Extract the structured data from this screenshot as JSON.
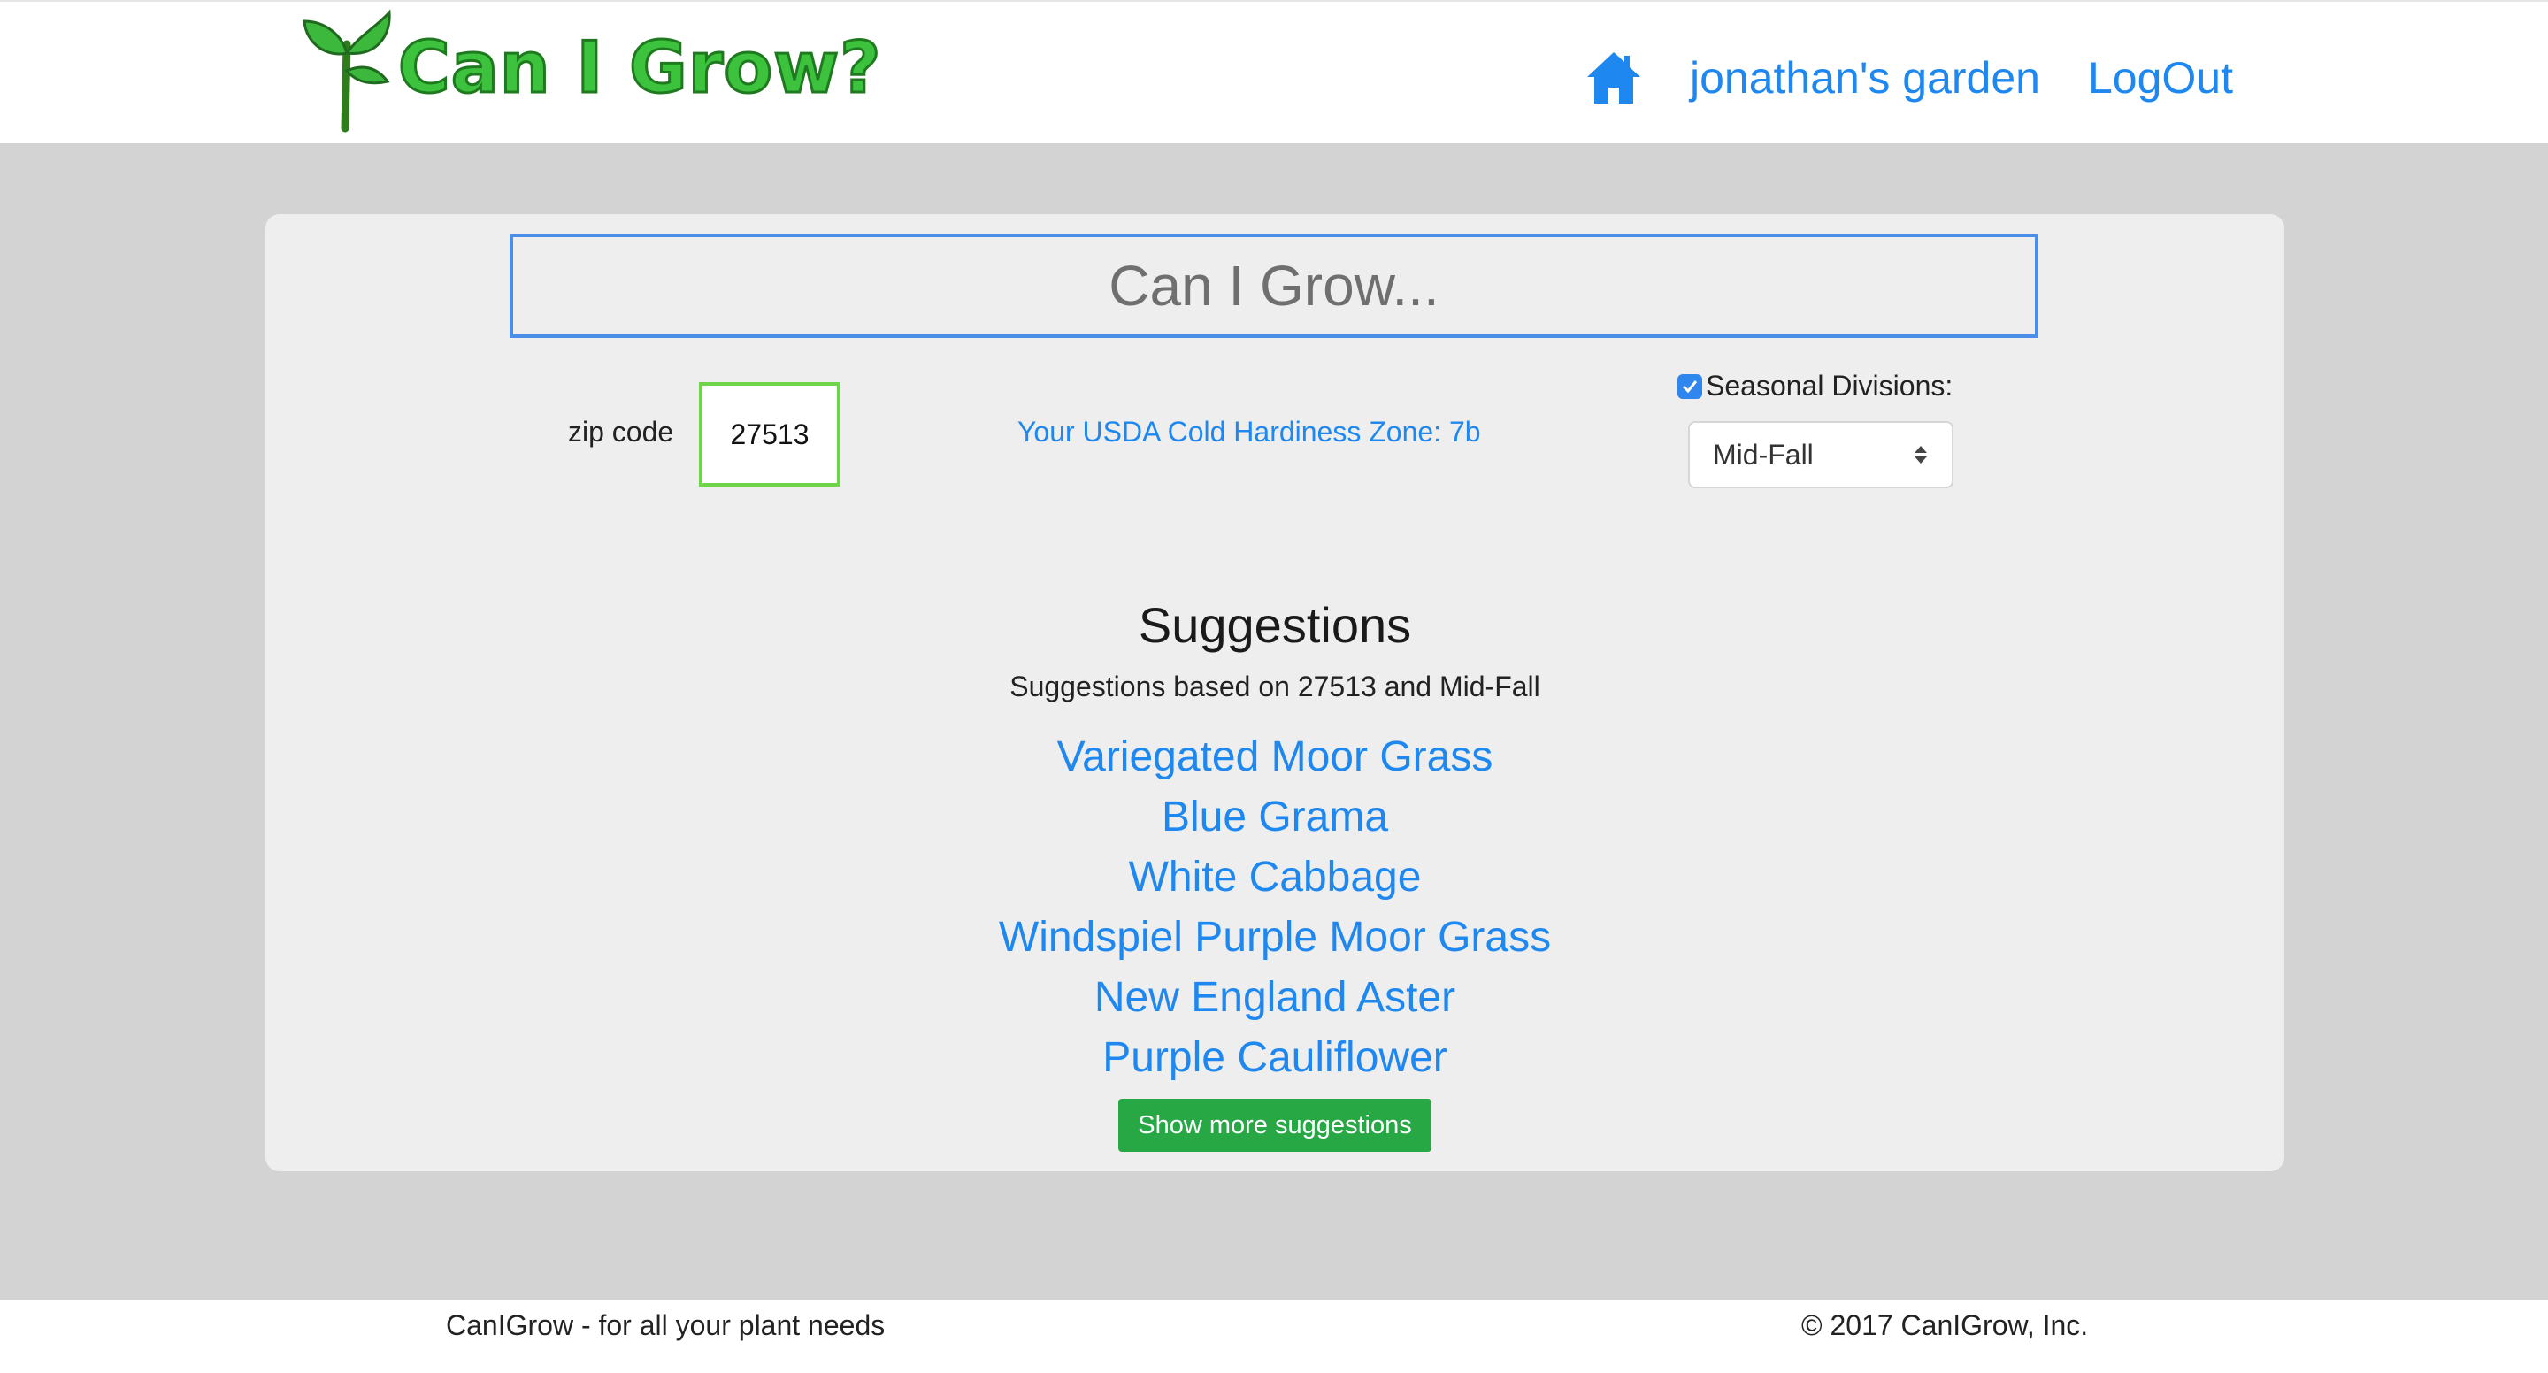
{
  "header": {
    "logo_text": "Can I Grow?",
    "nav": {
      "home_icon": "home-icon",
      "garden_link": "jonathan's garden",
      "logout_link": "LogOut"
    }
  },
  "search": {
    "placeholder": "Can I Grow..."
  },
  "location": {
    "zip_label": "zip code",
    "zip_value": "27513",
    "zone_text": "Your USDA Cold Hardiness Zone: 7b"
  },
  "seasonal": {
    "checked": true,
    "label": "Seasonal Divisions:",
    "selected": "Mid-Fall"
  },
  "suggestions": {
    "title": "Suggestions",
    "subtitle": "Suggestions based on 27513 and Mid-Fall",
    "items": [
      "Variegated Moor Grass",
      "Blue Grama",
      "White Cabbage",
      "Windspiel Purple Moor Grass",
      "New England Aster",
      "Purple Cauliflower"
    ],
    "more_button": "Show more suggestions"
  },
  "footer": {
    "left": "CanIGrow - for all your plant needs",
    "right": "© 2017 CanIGrow, Inc."
  },
  "colors": {
    "link_blue": "#1e88f0",
    "brand_green": "#3cc23c",
    "button_green": "#28a745",
    "page_bg": "#d3d3d3",
    "panel_bg": "#eeeeee"
  }
}
